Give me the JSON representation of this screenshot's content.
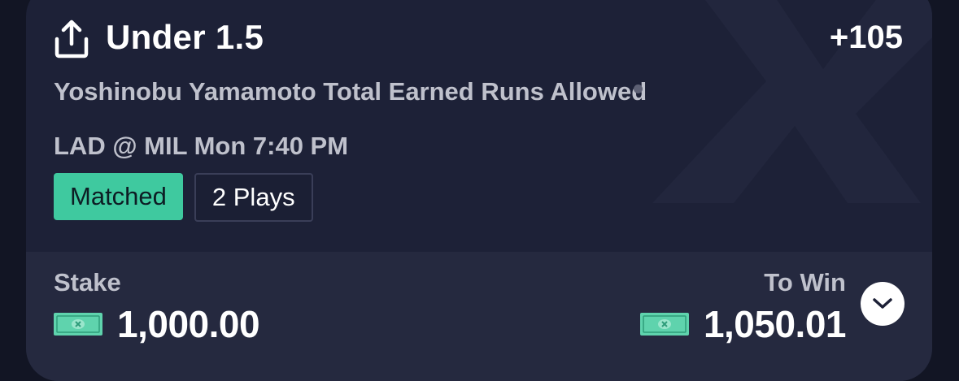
{
  "bet": {
    "pick": "Under 1.5",
    "odds": "+105",
    "market": "Yoshinobu Yamamoto Total Earned Runs Allowed",
    "matchup": "LAD @ MIL Mon 7:40 PM",
    "status_badge": "Matched",
    "plays_badge": "2 Plays"
  },
  "footer": {
    "stake_label": "Stake",
    "stake_amount": "1,000.00",
    "to_win_label": "To Win",
    "to_win_amount": "1,050.01"
  },
  "icons": {
    "share": "share-icon",
    "cash": "cash-icon",
    "expand": "chevron-down-icon"
  },
  "colors": {
    "background": "#121524",
    "card": "#1d2137",
    "footer": "#25293f",
    "accent_green": "#3fc99f",
    "muted_text": "#bfc1cc"
  }
}
